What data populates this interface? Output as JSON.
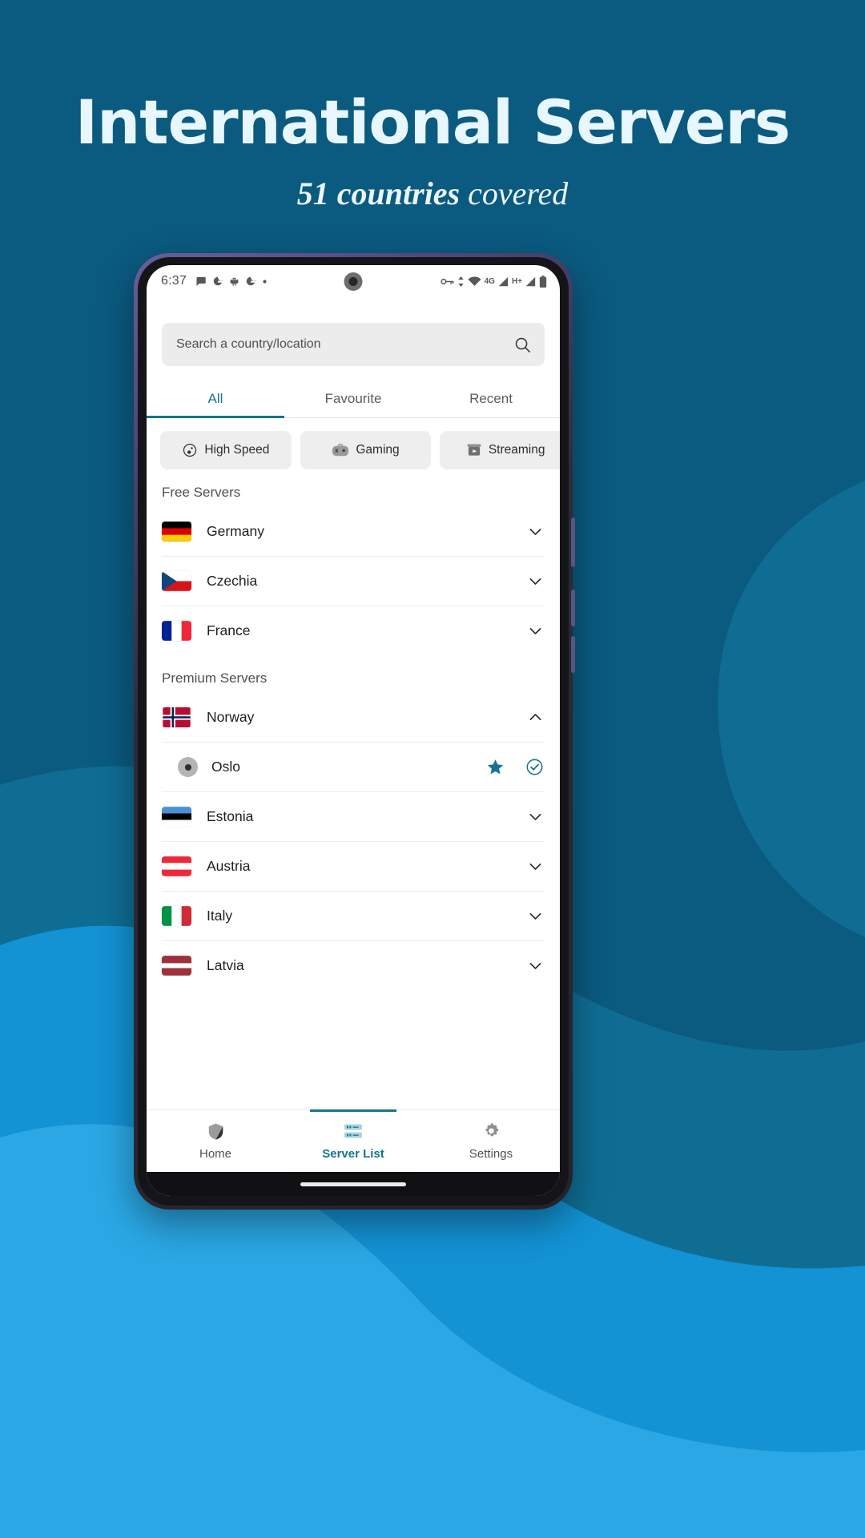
{
  "promo": {
    "title": "International Servers",
    "subtitle_highlight": "51 countries",
    "subtitle_rest": " covered",
    "bg_color": "#0b5a80",
    "wave_color_1": "#0f6d94",
    "wave_color_2": "#1392d4",
    "wave_color_3": "#2aa7e4"
  },
  "status_bar": {
    "time": "6:37",
    "left_icons": [
      "chat-bubble-icon",
      "google-icon",
      "android-icon",
      "google-icon",
      "dot-icon"
    ],
    "right_icons": [
      "vpn-key-icon",
      "data-transfer-icon",
      "wifi-icon",
      "signal-bars-icon",
      "signal-bars-icon",
      "battery-icon"
    ],
    "network_label": "4G",
    "network_label_2": "H+"
  },
  "search": {
    "placeholder": "Search a country/location",
    "icon": "search-icon"
  },
  "tabs": [
    {
      "label": "All",
      "active": true
    },
    {
      "label": "Favourite",
      "active": false
    },
    {
      "label": "Recent",
      "active": false
    }
  ],
  "chips": [
    {
      "label": "High Speed",
      "icon": "speedometer-icon"
    },
    {
      "label": "Gaming",
      "icon": "gamepad-icon"
    },
    {
      "label": "Streaming",
      "icon": "streaming-tv-icon"
    }
  ],
  "sections": [
    {
      "title": "Free Servers",
      "rows": [
        {
          "name": "Germany",
          "flag": "de",
          "chevron": "chevron-down-icon"
        },
        {
          "name": "Czechia",
          "flag": "cz",
          "chevron": "chevron-down-icon"
        },
        {
          "name": "France",
          "flag": "fr",
          "chevron": "chevron-down-icon"
        }
      ]
    },
    {
      "title": "Premium Servers",
      "rows": [
        {
          "name": "Norway",
          "flag": "no",
          "chevron": "chevron-up-icon",
          "expanded": true,
          "children": [
            {
              "name": "Oslo",
              "icon": "location-dot-icon",
              "favourite": true,
              "favourite_icon": "star-filled-icon",
              "selected_icon": "check-circle-icon"
            }
          ]
        },
        {
          "name": "Estonia",
          "flag": "ee",
          "chevron": "chevron-down-icon"
        },
        {
          "name": "Austria",
          "flag": "at",
          "chevron": "chevron-down-icon"
        },
        {
          "name": "Italy",
          "flag": "it",
          "chevron": "chevron-down-icon"
        },
        {
          "name": "Latvia",
          "flag": "lv",
          "chevron": "chevron-down-icon"
        }
      ]
    }
  ],
  "bottom_nav": [
    {
      "label": "Home",
      "icon": "shield-icon",
      "active": false
    },
    {
      "label": "Server List",
      "icon": "server-list-icon",
      "active": true
    },
    {
      "label": "Settings",
      "icon": "gear-icon",
      "active": false
    }
  ],
  "accent_color": "#14758f"
}
